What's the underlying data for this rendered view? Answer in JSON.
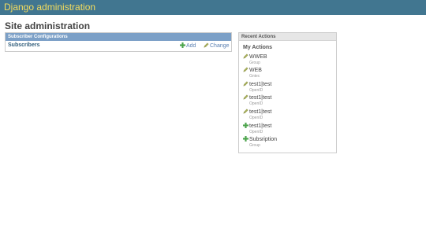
{
  "header": {
    "brand": "Django administration"
  },
  "page": {
    "title": "Site administration"
  },
  "app_module": {
    "caption": "Subscriber Configurations",
    "model": {
      "name": "Subscribers",
      "add_label": "Add",
      "change_label": "Change"
    }
  },
  "recent_actions": {
    "caption": "Recent Actions",
    "subtitle": "My Actions",
    "items": [
      {
        "name": "WWEB",
        "type": "Group",
        "icon": "pencil-icon"
      },
      {
        "name": "WEB",
        "type": "Gntec",
        "icon": "pencil-icon"
      },
      {
        "name": "test1|test",
        "type": "OpenID",
        "icon": "pencil-icon"
      },
      {
        "name": "test1|test",
        "type": "OpenID",
        "icon": "pencil-icon"
      },
      {
        "name": "test1|test",
        "type": "OpenID",
        "icon": "pencil-icon"
      },
      {
        "name": "test1|test",
        "type": "OpenID",
        "icon": "add-icon"
      },
      {
        "name": "Subsription",
        "type": "Group",
        "icon": "add-icon"
      }
    ]
  },
  "colors": {
    "header_bg": "#417690",
    "brand_text": "#f5dd5d",
    "module_caption_bg": "#7ca0c7",
    "link": "#5b80b2",
    "add_icon": "#4aa34a",
    "pencil_icon": "#a8b15a"
  }
}
